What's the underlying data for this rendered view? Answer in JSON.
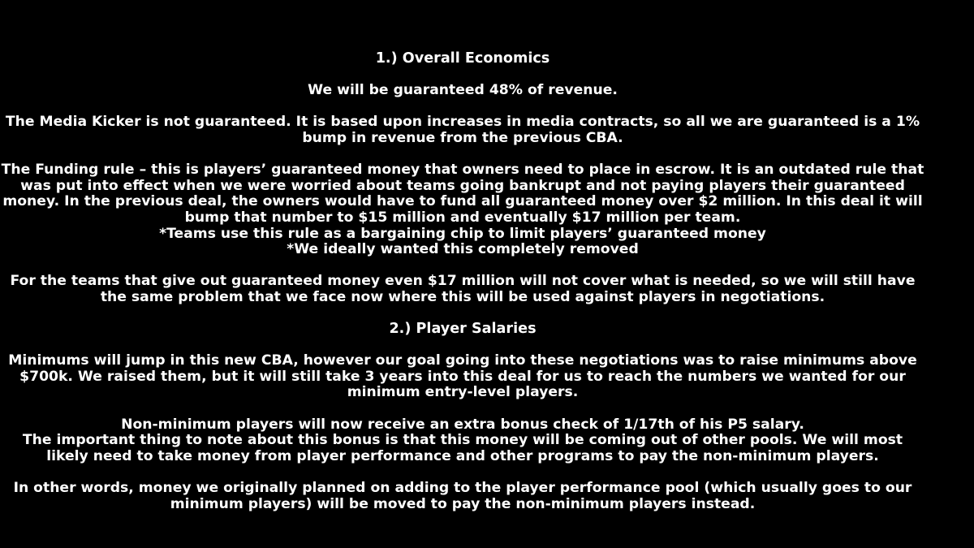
{
  "document": {
    "section1": {
      "heading": "1.) Overall Economics",
      "p1": "We will be guaranteed 48% of revenue.",
      "p2": "The Media Kicker is not guaranteed. It is based upon increases in media contracts, so all we are guaranteed is a 1% bump in revenue from the previous CBA.",
      "p3": "The Funding rule – this is players’ guaranteed money that owners need to place in escrow. It is an outdated rule that was put into effect when we were worried about teams going bankrupt and not paying players their guaranteed money. In the previous deal, the owners would have to fund all guaranteed money over $2 million. In this deal it will bump that number to $15 million and eventually $17 million per team.",
      "note1": "*Teams use this rule as a bargaining chip to limit players’ guaranteed money",
      "note2": "*We ideally wanted this completely removed",
      "p4": "For the teams that give out guaranteed money even $17 million will not cover what is needed, so we will still have the same problem that we face now where this will be used against players in negotiations."
    },
    "section2": {
      "heading": "2.) Player Salaries",
      "p1": "Minimums will jump in this new CBA, however our goal going into these negotiations was to raise minimums above $700k. We raised them, but it will still take 3 years into this deal for us to reach the numbers we wanted for our minimum entry-level players.",
      "p2": "Non-minimum players will now receive an extra bonus check of 1/17th of his P5 salary.",
      "p3": "The important thing to note about this bonus is that this money will be coming out of other pools. We will most likely need to take money from player performance and other programs to pay the non-minimum players.",
      "p4": "In other words, money we originally planned on adding to the player performance pool (which usually goes to our minimum players) will be moved to pay the non-minimum players instead."
    }
  }
}
